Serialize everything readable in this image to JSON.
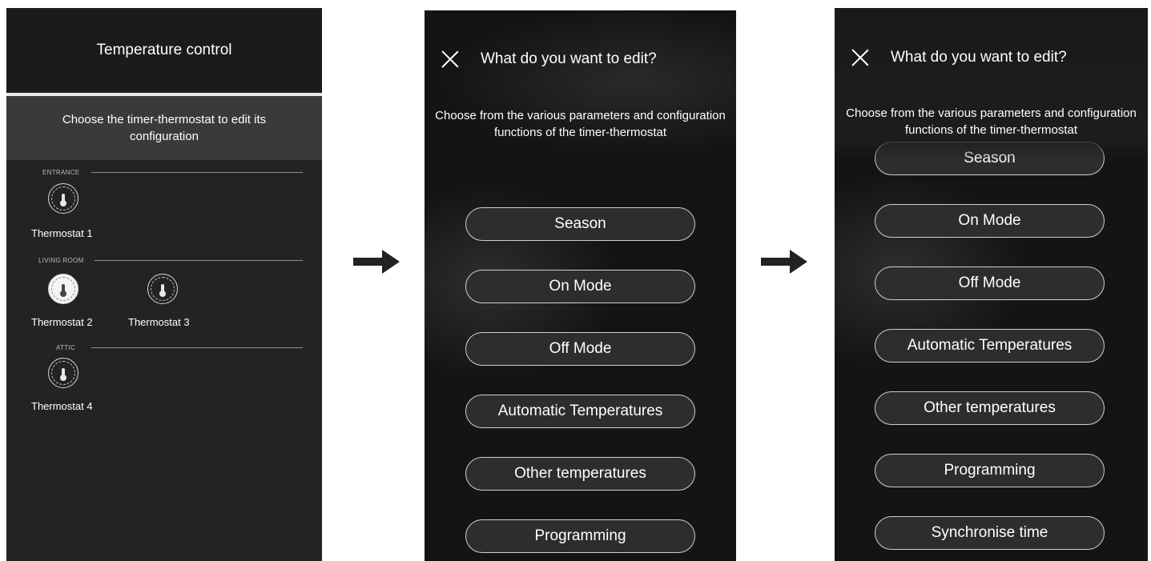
{
  "screen1": {
    "title": "Temperature control",
    "subtitle": "Choose the timer-thermostat to edit its configuration",
    "rooms": [
      {
        "label": "ENTRANCE",
        "thermostats": [
          {
            "name": "Thermostat 1",
            "selected": false
          }
        ]
      },
      {
        "label": "LIVING ROOM",
        "thermostats": [
          {
            "name": "Thermostat 2",
            "selected": true
          },
          {
            "name": "Thermostat 3",
            "selected": false
          }
        ]
      },
      {
        "label": "ATTIC",
        "thermostats": [
          {
            "name": "Thermostat 4",
            "selected": false
          }
        ]
      }
    ]
  },
  "screen2": {
    "title": "What do you want to edit?",
    "subtitle": "Choose from the various parameters and configuration functions of the timer-thermostat",
    "options": [
      "Season",
      "On Mode",
      "Off Mode",
      "Automatic Temperatures",
      "Other temperatures",
      "Programming"
    ]
  },
  "screen3": {
    "title": "What do you want to edit?",
    "subtitle": "Choose from the various parameters and configuration functions of the timer-thermostat",
    "options": [
      "Season",
      "On Mode",
      "Off Mode",
      "Automatic Temperatures",
      "Other temperatures",
      "Programming",
      "Synchronise time"
    ]
  },
  "icons": {
    "close": "close-icon",
    "thermostat": "thermometer-dial-icon",
    "flow": "arrow-right-icon"
  }
}
